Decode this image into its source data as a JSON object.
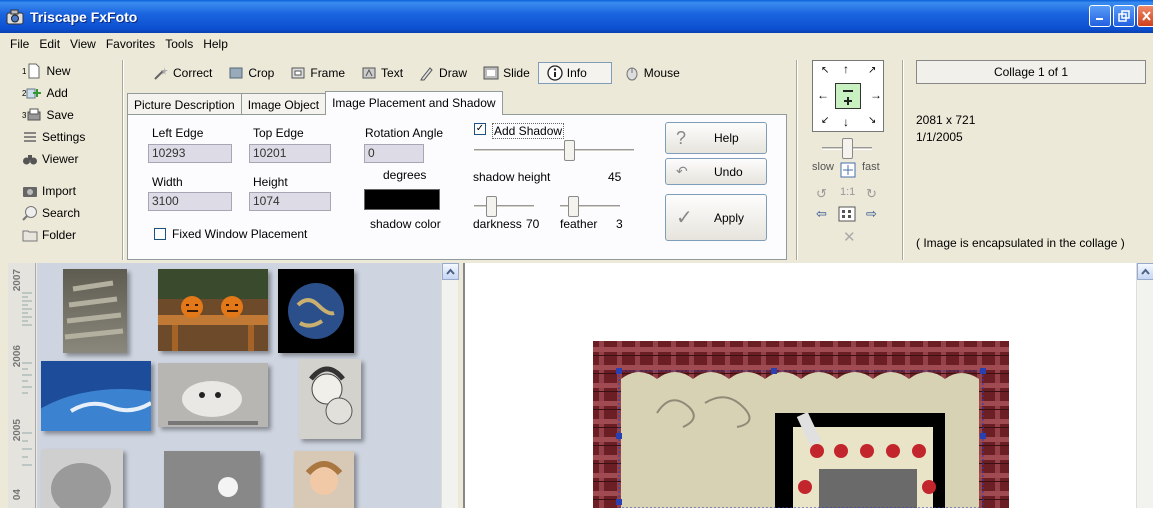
{
  "window": {
    "title": "Triscape FxFoto",
    "app_icon": "camera-icon"
  },
  "menu": [
    "File",
    "Edit",
    "View",
    "Favorites",
    "Tools",
    "Help"
  ],
  "left_commands": {
    "new": "New",
    "add": "Add",
    "save": "Save",
    "settings": "Settings",
    "viewer": "Viewer",
    "import": "Import",
    "search": "Search",
    "folder": "Folder",
    "badge_new": "1",
    "badge_add": "2",
    "badge_save": "3"
  },
  "toolbar": {
    "correct": "Correct",
    "crop": "Crop",
    "frame": "Frame",
    "text": "Text",
    "draw": "Draw",
    "slide": "Slide",
    "info": "Info",
    "mouse": "Mouse"
  },
  "tabs": [
    "Picture Description",
    "Image Object",
    "Image Placement and Shadow"
  ],
  "placement": {
    "left_edge_label": "Left Edge",
    "left_edge_value": "10293",
    "top_edge_label": "Top Edge",
    "top_edge_value": "10201",
    "rotation_label": "Rotation Angle",
    "rotation_value": "0",
    "degrees_label": "degrees",
    "width_label": "Width",
    "width_value": "3100",
    "height_label": "Height",
    "height_value": "1074",
    "fixed_window_label": "Fixed Window Placement"
  },
  "shadow": {
    "add_shadow_label": "Add Shadow",
    "add_shadow_checked": true,
    "shadow_color_label": "shadow color",
    "shadow_color": "#000000",
    "shadow_height_label": "shadow height",
    "shadow_height_value": "45",
    "shadow_height_level": 0.6,
    "darkness_label": "darkness",
    "darkness_value": "70",
    "feather_label": "feather",
    "feather_value": "3"
  },
  "actions": {
    "help": "Help",
    "undo": "Undo",
    "apply": "Apply"
  },
  "nav": {
    "slow": "slow",
    "fast": "fast",
    "zoom_one": "1:1"
  },
  "info": {
    "collage_label": "Collage 1 of 1",
    "dimensions": "2081 x 721",
    "date": "1/1/2005",
    "note": "( Image is encapsulated in the collage )"
  },
  "timeline": {
    "years": [
      "2007",
      "2006",
      "2005",
      "04"
    ]
  },
  "colors": {
    "titlebar": "#0b4fd0",
    "accent_border": "#7f9db9",
    "thumbs_bg": "#ced4e0"
  }
}
